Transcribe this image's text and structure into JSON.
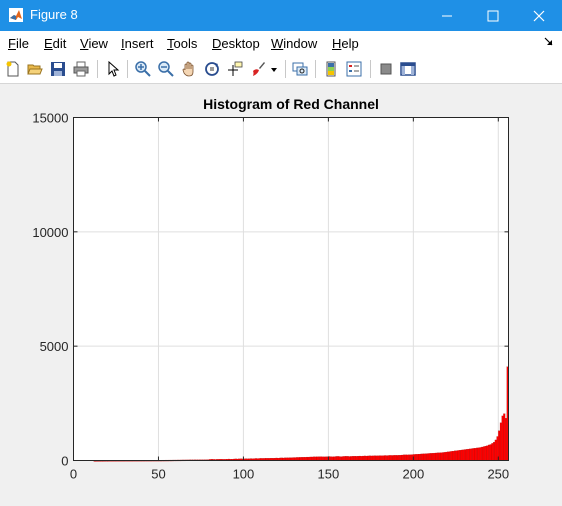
{
  "window": {
    "title": "Figure 8",
    "accent": "#1f90e6"
  },
  "menu": {
    "items": [
      "File",
      "Edit",
      "View",
      "Insert",
      "Tools",
      "Desktop",
      "Window",
      "Help"
    ]
  },
  "toolbar": {
    "buttons": [
      "new-figure-icon",
      "open-file-icon",
      "save-icon",
      "print-icon",
      "pointer-icon",
      "zoom-in-icon",
      "zoom-out-icon",
      "pan-icon",
      "rotate-3d-icon",
      "data-cursor-icon",
      "brush-icon",
      "link-plot-icon",
      "colorbar-icon",
      "legend-icon",
      "hide-plot-tools-icon",
      "show-plot-tools-icon"
    ]
  },
  "chart_data": {
    "type": "bar",
    "title": "Histogram of Red Channel",
    "xlabel": "",
    "ylabel": "",
    "xlim": [
      0,
      256
    ],
    "ylim": [
      0,
      15000
    ],
    "xticks": [
      "0",
      "50",
      "100",
      "150",
      "200",
      "250"
    ],
    "yticks": [
      "0",
      "5000",
      "10000",
      "15000"
    ],
    "grid": true,
    "bar_color": "#ff0000",
    "bin_start": 0,
    "values": [
      0,
      0,
      0,
      0,
      0,
      0,
      0,
      0,
      0,
      0,
      0,
      0,
      2,
      2,
      3,
      3,
      3,
      3,
      4,
      4,
      4,
      5,
      5,
      5,
      5,
      6,
      6,
      7,
      7,
      7,
      8,
      8,
      8,
      9,
      9,
      10,
      10,
      10,
      11,
      11,
      12,
      12,
      13,
      13,
      14,
      14,
      15,
      15,
      16,
      16,
      17,
      17,
      18,
      18,
      19,
      19,
      20,
      20,
      21,
      22,
      22,
      23,
      23,
      24,
      25,
      25,
      26,
      26,
      27,
      28,
      28,
      29,
      30,
      30,
      31,
      32,
      33,
      34,
      35,
      40,
      50,
      55,
      50,
      45,
      50,
      55,
      60,
      55,
      50,
      55,
      60,
      65,
      60,
      60,
      65,
      70,
      65,
      70,
      75,
      70,
      75,
      80,
      75,
      80,
      85,
      80,
      85,
      90,
      85,
      90,
      95,
      90,
      95,
      100,
      95,
      100,
      105,
      100,
      105,
      110,
      105,
      110,
      115,
      110,
      115,
      120,
      120,
      125,
      125,
      130,
      130,
      135,
      135,
      140,
      140,
      145,
      145,
      150,
      150,
      155,
      155,
      160,
      160,
      165,
      165,
      170,
      165,
      160,
      165,
      170,
      175,
      170,
      165,
      170,
      175,
      180,
      175,
      170,
      175,
      180,
      185,
      180,
      175,
      180,
      185,
      190,
      185,
      190,
      195,
      190,
      195,
      200,
      195,
      200,
      205,
      200,
      205,
      210,
      205,
      210,
      215,
      210,
      215,
      220,
      215,
      220,
      225,
      220,
      225,
      230,
      225,
      230,
      235,
      240,
      245,
      250,
      245,
      250,
      255,
      260,
      265,
      270,
      275,
      280,
      285,
      290,
      295,
      300,
      305,
      310,
      315,
      320,
      325,
      330,
      335,
      340,
      345,
      350,
      360,
      370,
      380,
      390,
      400,
      410,
      420,
      430,
      440,
      450,
      460,
      470,
      480,
      490,
      500,
      510,
      520,
      530,
      540,
      550,
      560,
      570,
      590,
      610,
      630,
      650,
      680,
      700,
      750,
      800,
      900,
      1050,
      1300,
      1650,
      1950,
      2050,
      1850,
      4100
    ]
  }
}
